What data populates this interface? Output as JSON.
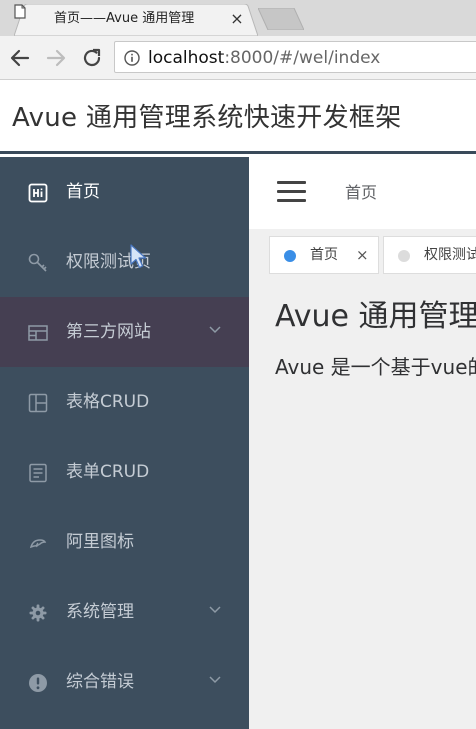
{
  "browser": {
    "tab_title": "首页——Avue 通用管理",
    "tab_close": "×",
    "url_host": "localhost",
    "url_rest": ":8000/#/wel/index"
  },
  "app": {
    "title": "Avue 通用管理系统快速开发框架"
  },
  "sidebar": {
    "items": [
      {
        "label": "首页",
        "icon": "home-hi-icon",
        "has_arrow": false,
        "active": false
      },
      {
        "label": "权限测试页",
        "icon": "key-icon",
        "has_arrow": false,
        "active": false
      },
      {
        "label": "第三方网站",
        "icon": "layout-icon",
        "has_arrow": true,
        "active": true
      },
      {
        "label": "表格CRUD",
        "icon": "table-grid-icon",
        "has_arrow": false,
        "active": false
      },
      {
        "label": "表单CRUD",
        "icon": "form-icon",
        "has_arrow": false,
        "active": false
      },
      {
        "label": "阿里图标",
        "icon": "aliyun-icon",
        "has_arrow": false,
        "active": false
      },
      {
        "label": "系统管理",
        "icon": "gear-icon",
        "has_arrow": true,
        "active": false
      },
      {
        "label": "综合错误",
        "icon": "warning-icon",
        "has_arrow": true,
        "active": false
      }
    ]
  },
  "main": {
    "breadcrumb": "首页",
    "tags": [
      {
        "label": "首页",
        "close": "×",
        "active": true
      },
      {
        "label": "权限测试页",
        "active": false
      }
    ],
    "content_title": "Avue 通用管理系统快速开发框架",
    "content_desc": "Avue 是一个基于vue的后台管理系统"
  },
  "colors": {
    "sidebar_bg": "#3d4e5e",
    "sidebar_active_bg": "#453f52",
    "tag_active_dot": "#3a8ee6",
    "main_bg": "#f0f0f0"
  }
}
